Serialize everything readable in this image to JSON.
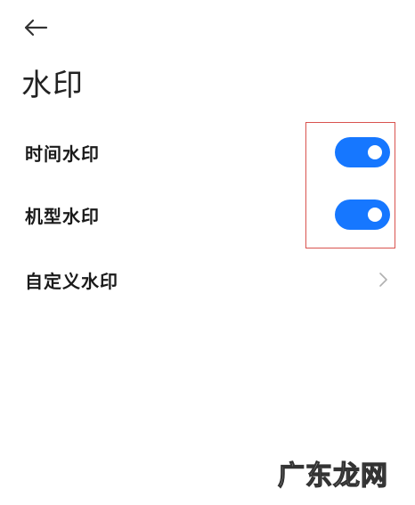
{
  "header": {
    "back_icon": "arrow-left-icon",
    "title": "水印"
  },
  "settings": [
    {
      "label": "时间水印",
      "type": "toggle",
      "enabled": true
    },
    {
      "label": "机型水印",
      "type": "toggle",
      "enabled": true
    },
    {
      "label": "自定义水印",
      "type": "navigate",
      "icon": "chevron-right-icon"
    }
  ],
  "watermark": {
    "text": "广东龙网"
  },
  "colors": {
    "toggle_on": "#1677ff",
    "highlight_border": "#d9534f"
  }
}
